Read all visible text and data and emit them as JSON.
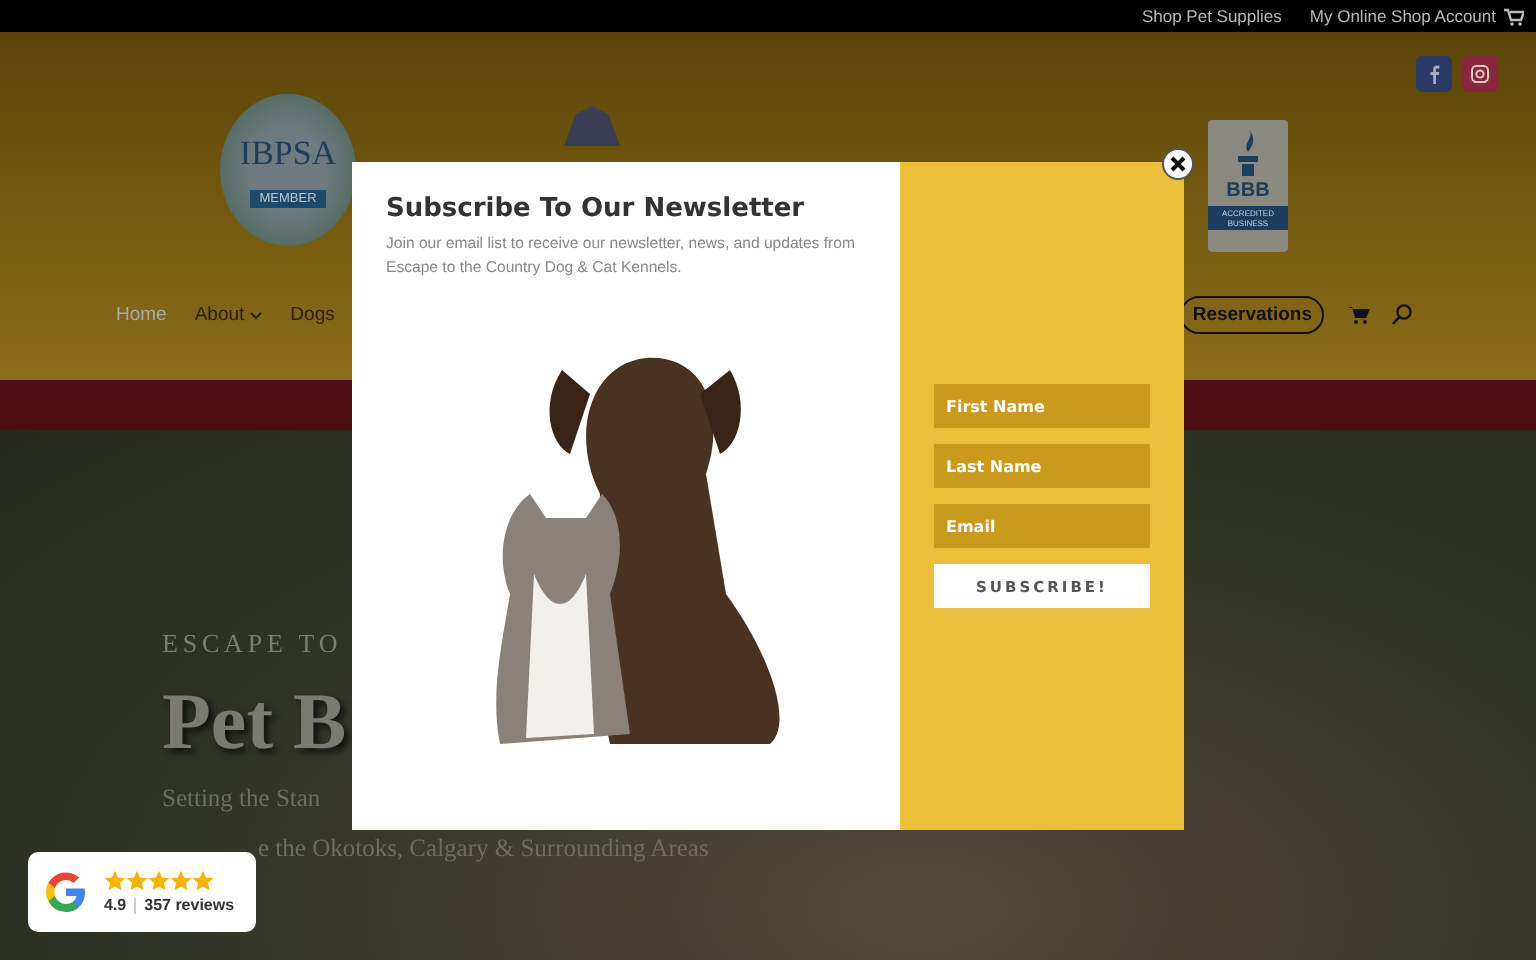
{
  "top_bar": {
    "links": [
      "Shop Pet Supplies",
      "My Online Shop Account"
    ]
  },
  "logos": {
    "left_badge": {
      "name": "IBPSA",
      "ribbon": "MEMBER"
    },
    "right_badge": {
      "name": "BBB",
      "caption": "ACCREDITED BUSINESS"
    }
  },
  "nav": {
    "items": [
      {
        "label": "Home",
        "selected": true,
        "has_dropdown": false
      },
      {
        "label": "About",
        "selected": false,
        "has_dropdown": true
      },
      {
        "label": "Dogs",
        "selected": false,
        "has_dropdown": false
      }
    ],
    "cta": "Reservations"
  },
  "hero": {
    "eyebrow": "ESCAPE TO",
    "title": "Pet B",
    "lines": [
      "Setting the Stan",
      "e the Okotoks, Calgary & Surrounding Areas"
    ]
  },
  "popup": {
    "title": "Subscribe To Our Newsletter",
    "description": "Join our email list to receive our newsletter, news, and updates from Escape to the Country Dog & Cat Kennels.",
    "fields": [
      {
        "placeholder": "First Name"
      },
      {
        "placeholder": "Last Name"
      },
      {
        "placeholder": "Email"
      }
    ],
    "button": "SUBSCRIBE!"
  },
  "review_badge": {
    "rating": "4.9",
    "stars": 5,
    "count": "357 reviews"
  }
}
